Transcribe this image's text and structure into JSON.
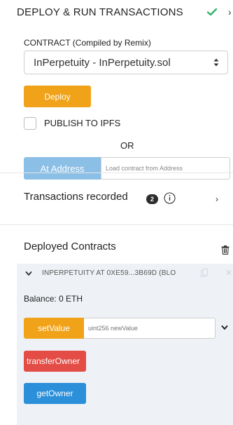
{
  "header": {
    "title": "DEPLOY & RUN TRANSACTIONS",
    "close_glyph": "›"
  },
  "contract": {
    "label_main": "CONTRACT",
    "label_sub": "(Compiled by Remix)",
    "selected": "InPerpetuity - InPerpetuity.sol"
  },
  "deploy": {
    "button_label": "Deploy",
    "publish_label": "PUBLISH TO IPFS",
    "publish_checked": false,
    "or_label": "OR",
    "at_address_label": "At Address",
    "address_placeholder": "Load contract from Address"
  },
  "transactions": {
    "label": "Transactions recorded",
    "count": "2",
    "chevron": "›"
  },
  "deployed": {
    "label": "Deployed Contracts",
    "instances": [
      {
        "title": "INPERPETUITY AT 0XE59...3B69D (BLO",
        "balance": "Balance: 0 ETH",
        "functions": [
          {
            "name": "setValue",
            "kind": "transact",
            "placeholder": "uint256 newValue"
          },
          {
            "name": "transferOwner",
            "kind": "payable"
          },
          {
            "name": "getOwner",
            "kind": "call"
          }
        ]
      }
    ]
  },
  "colors": {
    "deploy": "#f0a219",
    "at_address": "#8cbfe6",
    "transfer": "#e34d45",
    "call": "#2b8fd9",
    "check": "#2fb36b",
    "instance_bg": "#eef1f5"
  },
  "icons": [
    "check-icon",
    "close-icon",
    "select-arrows-icon",
    "info-icon",
    "chevron-right-icon",
    "trash-icon",
    "chevron-down-icon",
    "copy-icon"
  ]
}
